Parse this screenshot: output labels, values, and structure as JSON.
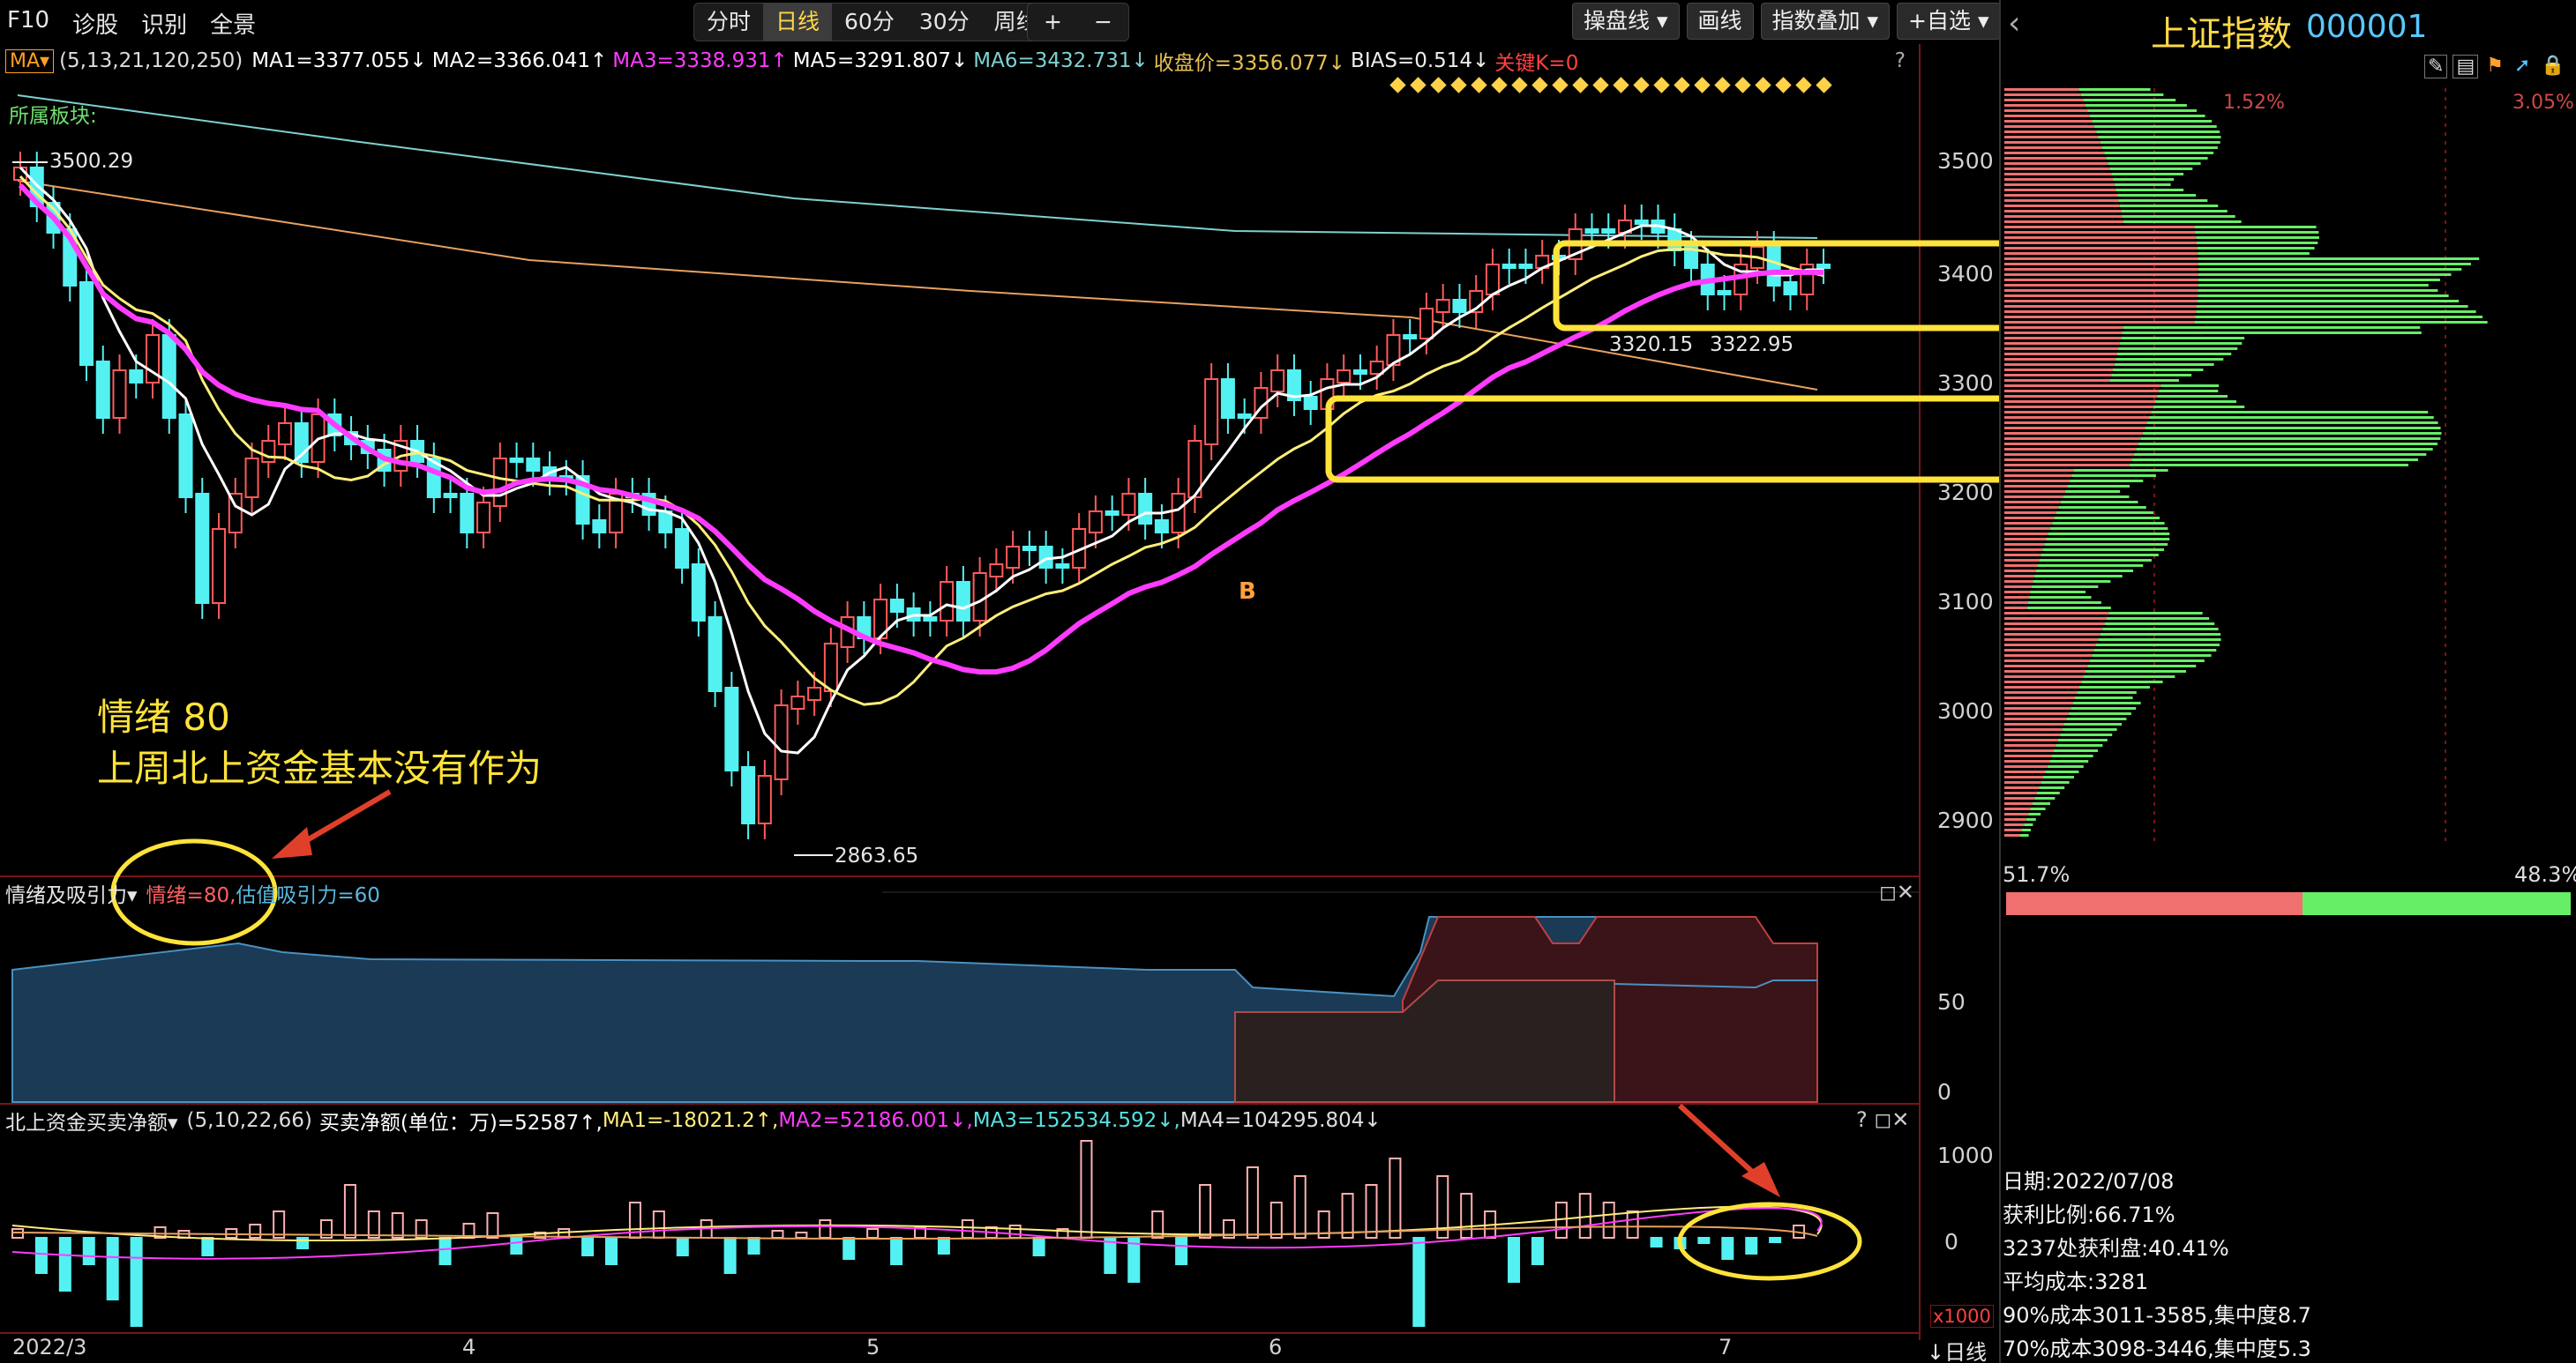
{
  "toolbar": {
    "left": [
      "F10",
      "诊股",
      "识别",
      "全景"
    ],
    "periods": [
      "分时",
      "日线",
      "60分",
      "30分",
      "周线"
    ],
    "active_period": "日线",
    "plus": "+",
    "minus": "−",
    "right": {
      "draw_line": "操盘线",
      "paint": "画线",
      "index_overlay": "指数叠加",
      "watchlist": "自选"
    }
  },
  "ma_bar": {
    "name": "MA",
    "params": "(5,13,21,120,250)",
    "ma1": "MA1=3377.055↓",
    "ma2": "MA2=3366.041↑",
    "ma3": "MA3=3338.931↑",
    "ma5": "MA5=3291.807↓",
    "ma6": "MA6=3432.731↓",
    "close": "收盘价=3356.077↓",
    "bias": "BIAS=0.514↓",
    "key": "关键K=0",
    "help": "?"
  },
  "sector_label": "所属板块:",
  "annotations": {
    "high": "3500.29",
    "low": "2863.65",
    "level1": "3320.15",
    "level2": "3322.95",
    "buy_mark": "B",
    "note_line1": "情绪 80",
    "note_line2": "上周北上资金基本没有作为"
  },
  "price_axis": [
    "3500",
    "3400",
    "3300",
    "3200",
    "3100",
    "3000",
    "2900"
  ],
  "sub1": {
    "name": "情绪及吸引力",
    "emotion": "情绪=80,",
    "attract": "估值吸引力=60",
    "axis": [
      "50",
      "0"
    ]
  },
  "sub2": {
    "name": "北上资金买卖净额",
    "params": "(5,10,22,66)",
    "net": "买卖净额(单位：万)=52587↑,",
    "ma1": "MA1=-18021.2↑,",
    "ma2": "MA2=52186.001↓,",
    "ma3": "MA3=152534.592↓,",
    "ma4": "MA4=104295.804↓",
    "axis": [
      "1000",
      "0"
    ],
    "unit": "x1000"
  },
  "x_axis": [
    "2022/3",
    "4",
    "5",
    "6",
    "7"
  ],
  "period_select": "↓日线",
  "right_panel": {
    "title": "上证指数",
    "code": "000001",
    "pct_left": "1.52%",
    "pct_right": "3.05%",
    "ratio_left": "51.7%",
    "ratio_right": "48.3%",
    "date": "日期:2022/07/08",
    "profit_ratio": "获利比例:66.71%",
    "profit_at": "3237处获利盘:40.41%",
    "avg_cost": "平均成本:3281",
    "cost90": "90%成本3011-3585,集中度8.7",
    "cost70": "70%成本3098-3446,集中度5.3"
  },
  "colors": {
    "up": "#ff5a5a",
    "down": "#54f1f3",
    "ma_white": "#ffffff",
    "ma_yellow": "#ffee7a",
    "ma_magenta": "#ff3bff",
    "highlight": "#ffe33a",
    "profit": "#f07070",
    "loss": "#66ee66"
  }
}
